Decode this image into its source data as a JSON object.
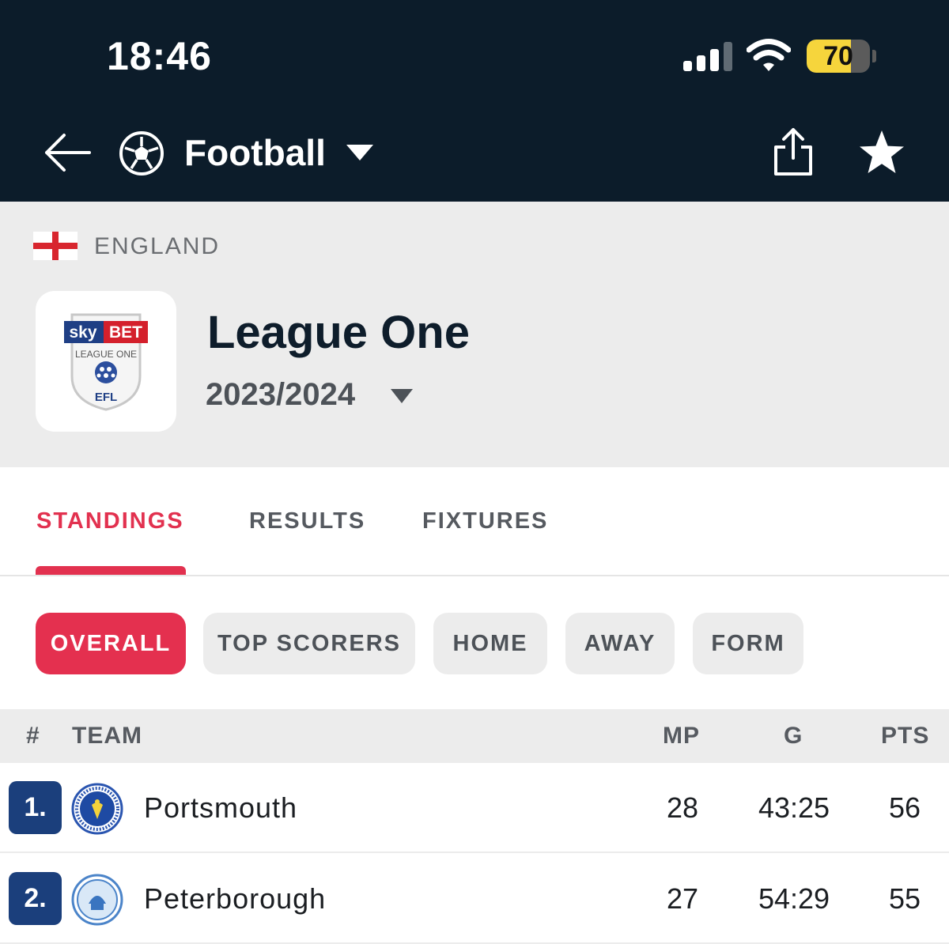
{
  "status_bar": {
    "time": "18:46",
    "battery_level": "70",
    "battery_percent": 70
  },
  "nav": {
    "title": "Football",
    "icons": [
      "back-arrow-icon",
      "football-icon",
      "chevron-down-icon",
      "share-icon",
      "star-icon"
    ]
  },
  "league": {
    "country": "ENGLAND",
    "name": "League One",
    "season": "2023/2024",
    "logo": {
      "line1": "sky",
      "line2": "BET",
      "line3": "LEAGUE ONE",
      "line4": "EFL"
    }
  },
  "tabs": [
    {
      "label": "STANDINGS",
      "active": true
    },
    {
      "label": "RESULTS",
      "active": false
    },
    {
      "label": "FIXTURES",
      "active": false
    }
  ],
  "filters": [
    {
      "label": "OVERALL",
      "active": true
    },
    {
      "label": "TOP SCORERS",
      "active": false
    },
    {
      "label": "HOME",
      "active": false
    },
    {
      "label": "AWAY",
      "active": false
    },
    {
      "label": "FORM",
      "active": false
    }
  ],
  "table": {
    "headers": {
      "rank": "#",
      "team": "TEAM",
      "mp": "MP",
      "g": "G",
      "pts": "PTS"
    },
    "rows": [
      {
        "rank": "1.",
        "team": "Portsmouth",
        "mp": "28",
        "g": "43:25",
        "pts": "56"
      },
      {
        "rank": "2.",
        "team": "Peterborough",
        "mp": "27",
        "g": "54:29",
        "pts": "55"
      }
    ]
  },
  "colors": {
    "header_bg": "#0c1c2a",
    "accent": "#e2314f",
    "rank_bg": "#1b3f7c",
    "battery": "#f6d53c"
  }
}
